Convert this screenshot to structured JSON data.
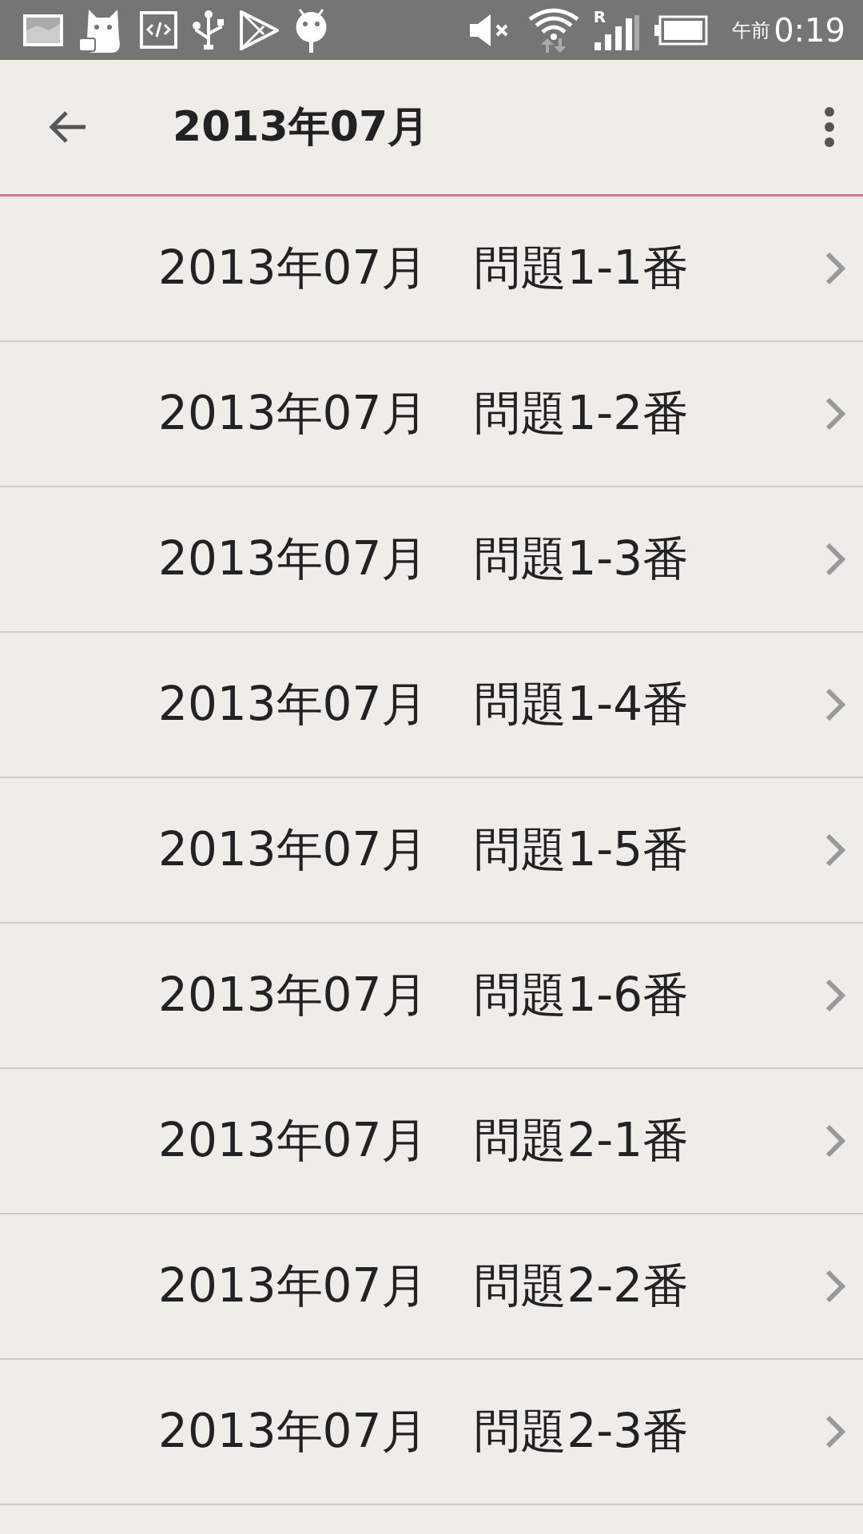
{
  "status_bar": {
    "roaming": "R",
    "time_prefix": "午前",
    "time": "0:19"
  },
  "toolbar": {
    "title": "2013年07月"
  },
  "rows": [
    {
      "label": "2013年07月　問題1-1番"
    },
    {
      "label": "2013年07月　問題1-2番"
    },
    {
      "label": "2013年07月　問題1-3番"
    },
    {
      "label": "2013年07月　問題1-4番"
    },
    {
      "label": "2013年07月　問題1-5番"
    },
    {
      "label": "2013年07月　問題1-6番"
    },
    {
      "label": "2013年07月　問題2-1番"
    },
    {
      "label": "2013年07月　問題2-2番"
    },
    {
      "label": "2013年07月　問題2-3番"
    }
  ]
}
